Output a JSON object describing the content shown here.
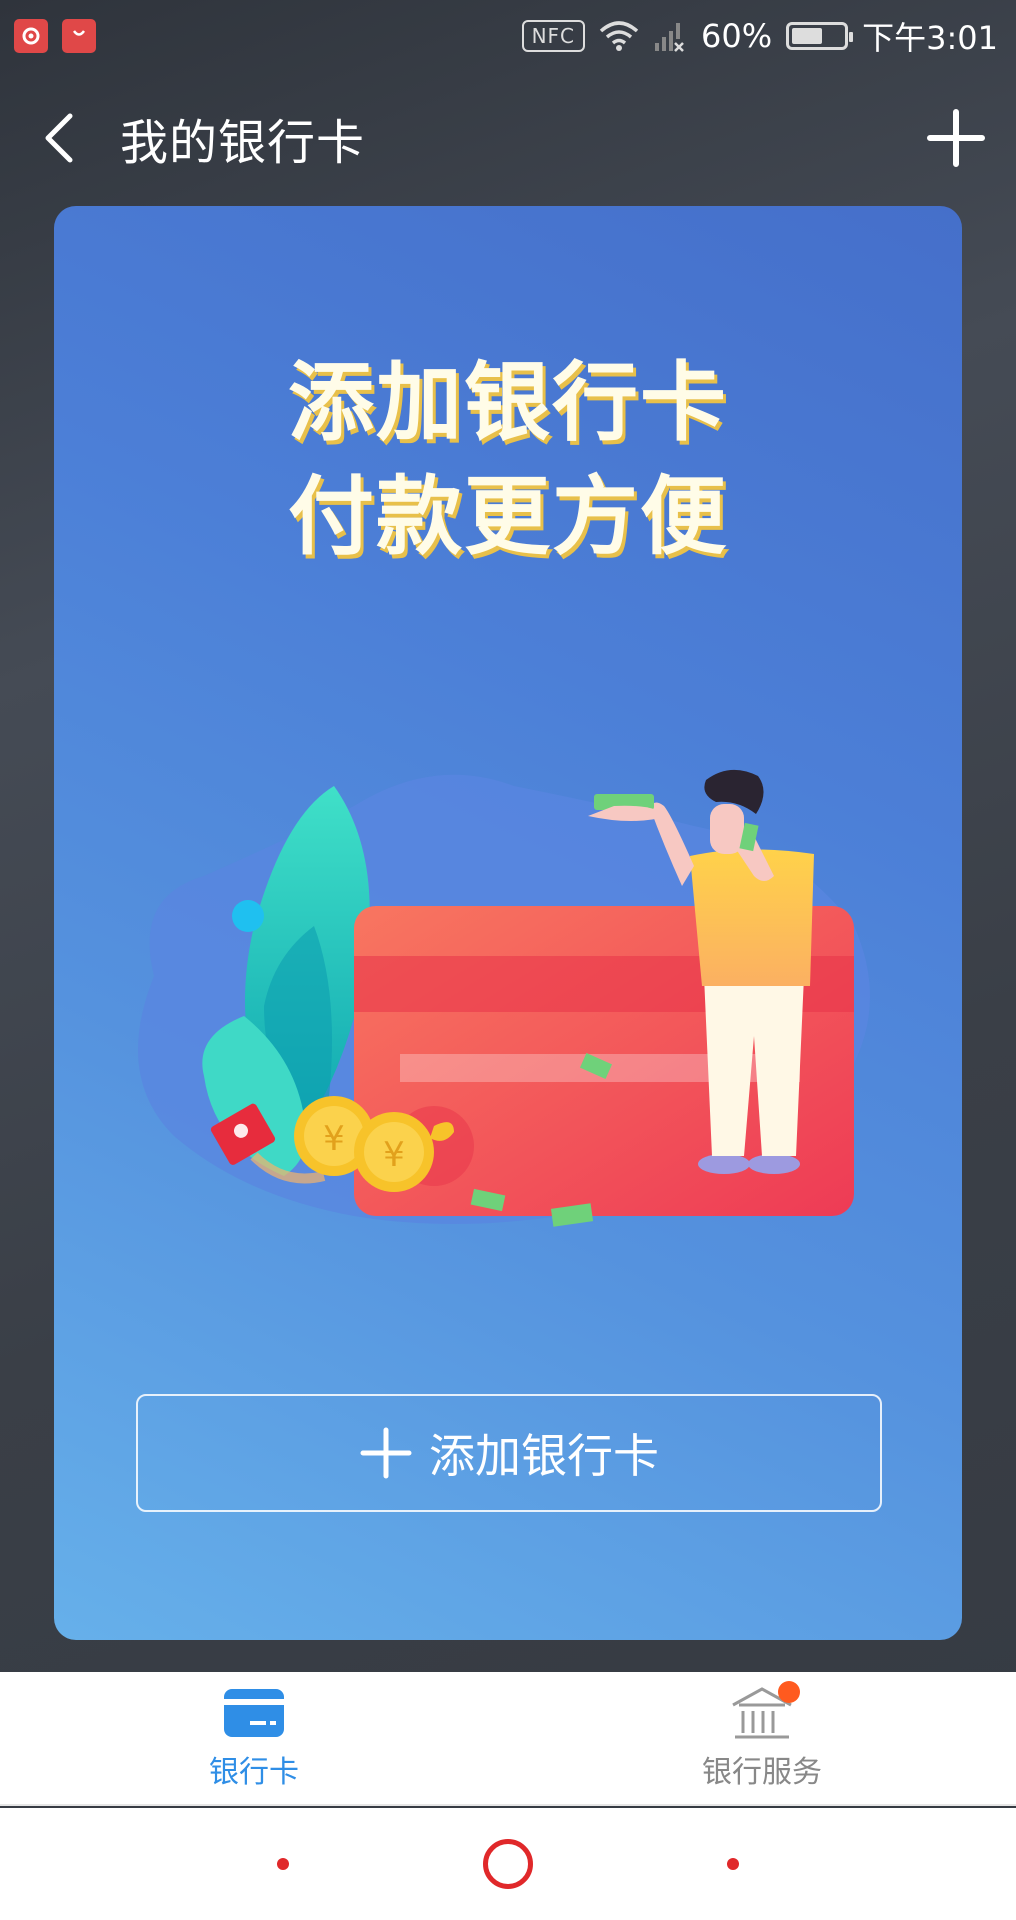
{
  "status_bar": {
    "nfc": "NFC",
    "battery": "60%",
    "time": "下午3:01"
  },
  "header": {
    "title": "我的银行卡"
  },
  "promo": {
    "line1": "添加银行卡",
    "line2": "付款更方便"
  },
  "add_button": {
    "label": "添加银行卡"
  },
  "tabs": [
    {
      "label": "银行卡",
      "active": true,
      "icon": "bank-card-icon"
    },
    {
      "label": "银行服务",
      "active": false,
      "icon": "bank-building-icon",
      "badge": true
    }
  ],
  "colors": {
    "accent": "#2f8ee6",
    "badge": "#ff5a1f",
    "title_gold": "#e8c04a"
  }
}
